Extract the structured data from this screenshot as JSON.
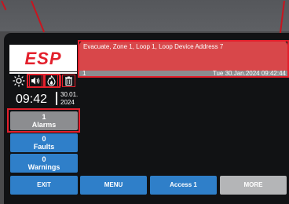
{
  "brand": {
    "logo_text": "ESP"
  },
  "clock": {
    "time": "09:42",
    "date_day_month": "30.01.",
    "date_year": "2024"
  },
  "indicators": [
    "sun-icon",
    "speaker-icon",
    "flame-icon",
    "trash-icon"
  ],
  "event": {
    "message": "Evacuate, Zone 1, Loop 1, Loop Device Address 7",
    "index": "1",
    "timestamp": "Tue 30.Jan.2024 09:42:44"
  },
  "counters": {
    "alarms": {
      "count": "1",
      "label": "Alarms"
    },
    "faults": {
      "count": "0",
      "label": "Faults"
    },
    "warnings": {
      "count": "0",
      "label": "Warnings"
    }
  },
  "bottom_bar": {
    "exit": "EXIT",
    "menu": "MENU",
    "access": "Access 1",
    "more": "MORE"
  },
  "colors": {
    "accent_red": "#e3202c",
    "button_blue": "#2f7fc9",
    "button_grey": "#8c8d90",
    "message_red": "#d8474a"
  }
}
